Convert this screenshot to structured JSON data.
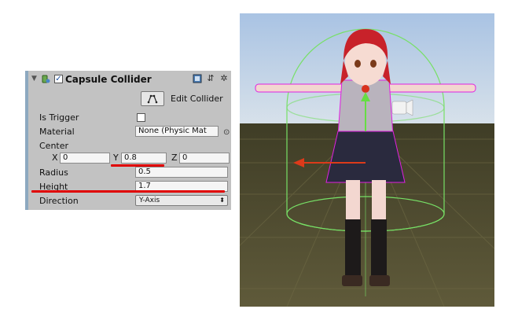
{
  "component": {
    "title": "Capsule Collider",
    "enabled": true,
    "edit_collider_label": "Edit Collider",
    "is_trigger_label": "Is Trigger",
    "is_trigger": false,
    "material_label": "Material",
    "material_value": "None (Physic Mat",
    "center_label": "Center",
    "center": {
      "x_label": "X",
      "x": "0",
      "y_label": "Y",
      "y": "0.8",
      "z_label": "Z",
      "z": "0"
    },
    "radius_label": "Radius",
    "radius": "0.5",
    "height_label": "Height",
    "height": "1.7",
    "direction_label": "Direction",
    "direction": "Y-Axis"
  },
  "colors": {
    "panel_bg": "#c2c2c2",
    "field_bg": "#f5f5f5",
    "highlight": "#e00000",
    "collider": "#66dd55",
    "sky": "#b9cfe6",
    "ground": "#4e4a2e"
  },
  "icons": [
    "foldout-arrow-icon",
    "component-icon",
    "enable-checkbox-icon",
    "book-icon",
    "preset-icon",
    "gear-icon",
    "edit-collider-icon",
    "object-picker-icon",
    "dropdown-arrow-icon",
    "move-arrow-icon",
    "camera-icon"
  ]
}
